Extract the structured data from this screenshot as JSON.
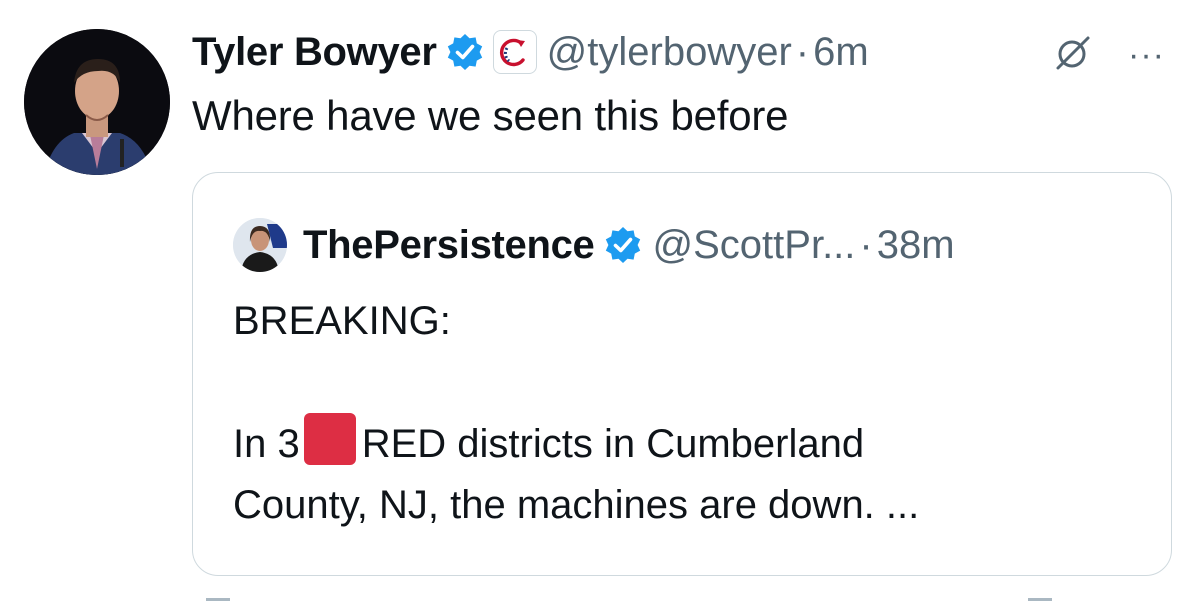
{
  "author": {
    "name": "Tyler Bowyer",
    "handle": "@tylerbowyer",
    "separator": "·",
    "time": "6m",
    "verified_icon": "verified-badge-icon",
    "affiliation_icon": "affiliate-badge-icon",
    "accent_color": "#1d9bf0"
  },
  "tweet": {
    "text": "Where have we seen this before"
  },
  "actions": {
    "grok_icon": "grok-icon",
    "more_label": "···"
  },
  "quoted": {
    "name": "ThePersistence",
    "handle": "@ScottPr...",
    "separator": "·",
    "time": "38m",
    "line1": "BREAKING:",
    "line2_prefix": "In 3",
    "line2_emoji": "red-square-emoji",
    "line2_suffix": "RED districts in Cumberland",
    "line3": "County, NJ, the machines are down. ..."
  }
}
